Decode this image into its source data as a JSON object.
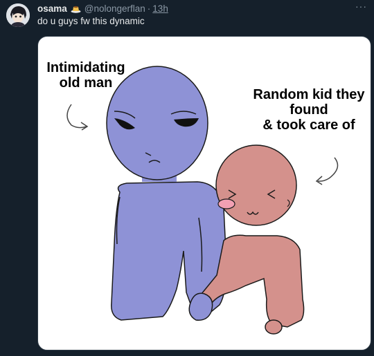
{
  "tweet": {
    "author_name": "osama",
    "author_emoji": "pudding-emoji",
    "handle": "@nolongerflan",
    "separator": "·",
    "time": "13h",
    "more": "···",
    "text": "do u guys fw this dynamic"
  },
  "image": {
    "label_left": "Intimidating\nold man",
    "label_right": "Random kid they\nfound\n& took care of"
  },
  "colors": {
    "background": "#15202b",
    "old_man": "#8e92d6",
    "kid": "#d4918c",
    "blush": "#f2a0b3"
  }
}
